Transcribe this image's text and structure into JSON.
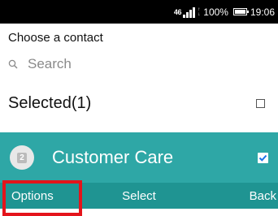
{
  "status_bar": {
    "network_type": "46",
    "battery_percent": "100%",
    "time": "19:06"
  },
  "header": {
    "title": "Choose a contact"
  },
  "search": {
    "placeholder": "Search",
    "icon": "search-icon"
  },
  "selected": {
    "label": "Selected(1)",
    "checked": false
  },
  "contacts": [
    {
      "avatar_number": "2",
      "name": "Customer Care",
      "checked": true
    }
  ],
  "softkeys": {
    "left": "Options",
    "center": "Select",
    "right": "Back"
  },
  "colors": {
    "status_bar": "#000000",
    "selected_row": "#2ea7a6",
    "softkey_bar": "#1f9492",
    "highlight": "#e4141b",
    "check_tick": "#1a73e8"
  }
}
